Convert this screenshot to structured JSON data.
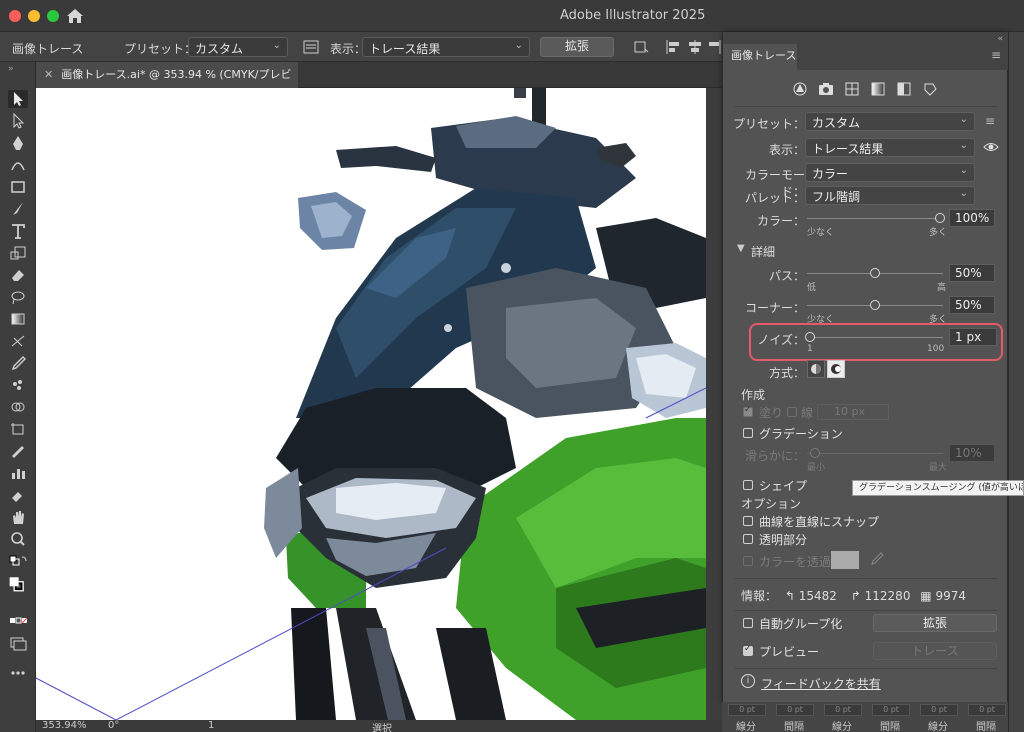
{
  "app": {
    "title": "Adobe Illustrator 2025"
  },
  "control_bar": {
    "panel_name": "画像トレース",
    "preset_label": "プリセット：",
    "preset_value": "カスタム",
    "view_label": "表示：",
    "view_value": "トレース結果",
    "expand_button": "拡張"
  },
  "document": {
    "tab_title": "画像トレース.ai* @ 353.94 % (CMYK/プレビュー)",
    "zoom": "353.94%",
    "rotation": "0°",
    "artboard": "1",
    "tool_status": "選択"
  },
  "panel": {
    "title": "画像トレース",
    "preset_icons": [
      "auto-color-icon",
      "camera-icon",
      "grid-icon",
      "grayscale-icon",
      "black-white-icon",
      "outline-icon"
    ],
    "preset_label": "プリセット：",
    "preset_value": "カスタム",
    "view_label": "表示：",
    "view_value": "トレース結果",
    "mode_label": "カラーモード：",
    "mode_value": "カラー",
    "palette_label": "パレット：",
    "palette_value": "フル階調",
    "colors": {
      "label": "カラー：",
      "min": "少なく",
      "max": "多く",
      "value": "100%",
      "level": 1.0
    },
    "advanced_label": "詳細",
    "paths": {
      "label": "パス：",
      "min": "低",
      "max": "高",
      "value": "50%",
      "level": 0.5
    },
    "corners": {
      "label": "コーナー：",
      "min": "少なく",
      "max": "多く",
      "value": "50%",
      "level": 0.5
    },
    "noise": {
      "label": "ノイズ：",
      "min": "1",
      "max": "100",
      "value": "1 px",
      "level": 0.0
    },
    "method_label": "方式：",
    "create_label": "作成",
    "fills_label": "塗り",
    "strokes_label": "線",
    "stroke_value": "10 px",
    "gradient_label": "グラデーション",
    "smoothness": {
      "label": "滑らかに：",
      "min": "最小",
      "max": "最大",
      "value": "10%"
    },
    "shapes_label": "シェイプ",
    "options_label": "オプション",
    "snap_label": "曲線を直線にスナップ",
    "transparency_label": "透明部分",
    "ignore_color_label": "カラーを透過",
    "info": {
      "label": "情報：",
      "paths": "15482",
      "anchors": "112280",
      "colors": "9974"
    },
    "auto_group_label": "自動グループ化",
    "expand_button": "拡張",
    "preview_label": "プレビュー",
    "trace_button": "トレース",
    "feedback_label": "フィードバックを共有"
  },
  "tooltip": "グラデーションスムージング (値が高いほど",
  "bottom_bar": {
    "fields": [
      "0 pt",
      "0 pt",
      "0 pt",
      "0 pt",
      "0 pt",
      "0 pt"
    ],
    "labels": [
      "線分",
      "間隔",
      "線分",
      "間隔",
      "線分",
      "間隔"
    ]
  },
  "colors": {
    "highlight": "#e55a6a",
    "panel_bg": "#535353",
    "bike_green": "#3fa12a"
  }
}
